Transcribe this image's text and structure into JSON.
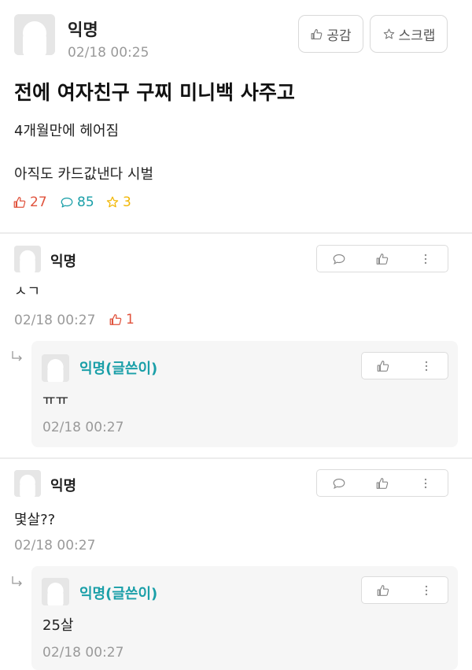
{
  "post": {
    "author": "익명",
    "timestamp": "02/18 00:25",
    "like_label": "공감",
    "scrap_label": "스크랩",
    "title": "전에 여자친구 구찌 미니백 사주고",
    "body_lines": [
      "4개월만에 헤어짐",
      "아직도 카드값낸다 시벌"
    ],
    "likes": "27",
    "comments": "85",
    "scraps": "3"
  },
  "comments": [
    {
      "author": "익명",
      "text": "ㅅㄱ",
      "timestamp": "02/18 00:27",
      "likes": "1",
      "reply": {
        "author": "익명(글쓴이)",
        "text": "ㅠㅠ",
        "timestamp": "02/18 00:27"
      }
    },
    {
      "author": "익명",
      "text": "몇살??",
      "timestamp": "02/18 00:27",
      "reply": {
        "author": "익명(글쓴이)",
        "text": "25살",
        "timestamp": "02/18 00:27"
      }
    }
  ],
  "colors": {
    "like_red": "#e0533d",
    "comment_teal": "#1a9fa8",
    "scrap_yellow": "#f2b705",
    "author_teal": "#1a9fa8"
  },
  "icons": [
    "thumbs-up-icon",
    "star-icon",
    "speech-bubble-icon",
    "more-vertical-icon",
    "reply-arrow-icon",
    "avatar-icon"
  ]
}
